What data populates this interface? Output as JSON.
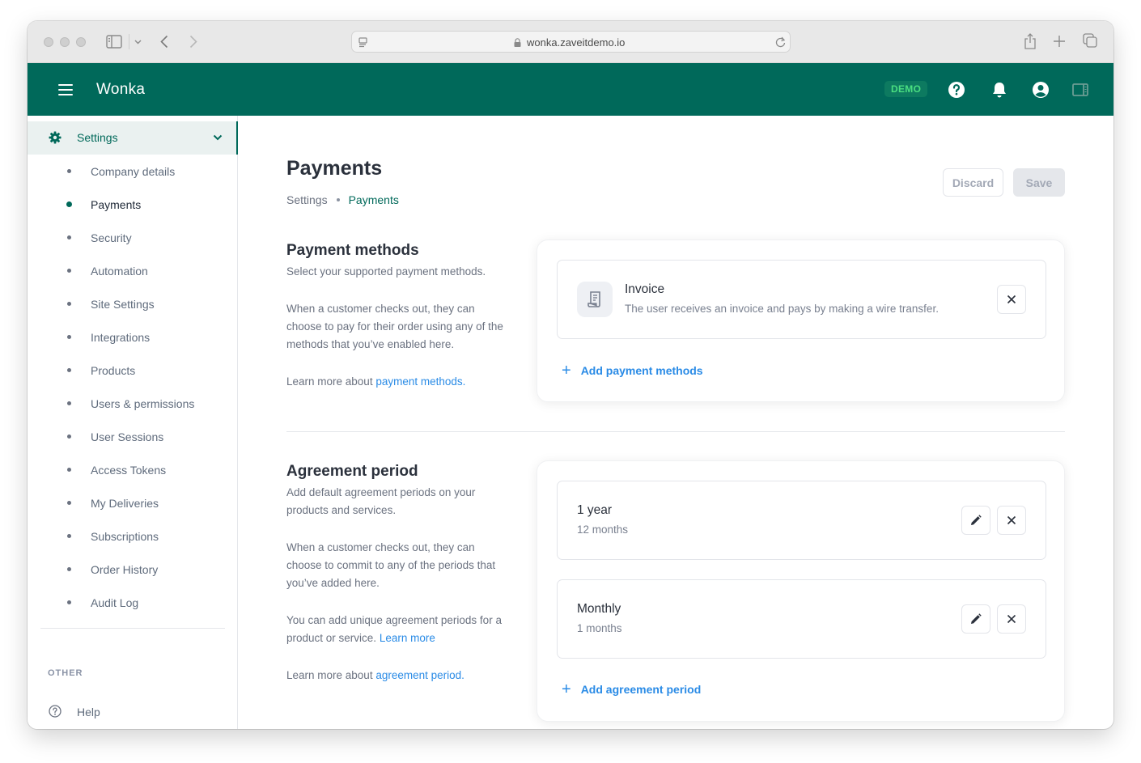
{
  "browser": {
    "url": "wonka.zaveitdemo.io"
  },
  "appbar": {
    "brand": "Wonka",
    "badge": "DEMO",
    "icons": [
      "menu-icon",
      "help-icon",
      "bell-icon",
      "account-icon",
      "sidebar-toggle-icon"
    ]
  },
  "sidebar": {
    "group_label": "Settings",
    "items": [
      {
        "label": "Company details",
        "active": false
      },
      {
        "label": "Payments",
        "active": true
      },
      {
        "label": "Security",
        "active": false
      },
      {
        "label": "Automation",
        "active": false
      },
      {
        "label": "Site Settings",
        "active": false
      },
      {
        "label": "Integrations",
        "active": false
      },
      {
        "label": "Products",
        "active": false
      },
      {
        "label": "Users & permissions",
        "active": false
      },
      {
        "label": "User Sessions",
        "active": false
      },
      {
        "label": "Access Tokens",
        "active": false
      },
      {
        "label": "My Deliveries",
        "active": false
      },
      {
        "label": "Subscriptions",
        "active": false
      },
      {
        "label": "Order History",
        "active": false
      },
      {
        "label": "Audit Log",
        "active": false
      }
    ],
    "other_heading": "OTHER",
    "help_label": "Help"
  },
  "main": {
    "title": "Payments",
    "breadcrumb": {
      "root": "Settings",
      "current": "Payments"
    },
    "discard_label": "Discard",
    "save_label": "Save",
    "payment_methods": {
      "title": "Payment methods",
      "subtitle": "Select your supported payment methods.",
      "body": "When a customer checks out, they can choose to pay for their order using any of the methods that you’ve enabled here.",
      "learn_prefix": "Learn more about",
      "learn_link": "payment methods.",
      "items": [
        {
          "title": "Invoice",
          "description": "The user receives an invoice and pays by making a wire transfer."
        }
      ],
      "add_label": "Add payment methods"
    },
    "agreement_period": {
      "title": "Agreement period",
      "subtitle": "Add default agreement periods on your products and services.",
      "body": "When a customer checks out, they can choose to commit to any of the periods that you’ve added here.",
      "unique_text": "You can add unique agreement periods for a product or service.",
      "unique_link": "Learn more",
      "learn_prefix": "Learn more about",
      "learn_link": "agreement period.",
      "items": [
        {
          "title": "1 year",
          "subtitle": "12 months"
        },
        {
          "title": "Monthly",
          "subtitle": "1 months"
        }
      ],
      "add_label": "Add agreement period"
    }
  }
}
